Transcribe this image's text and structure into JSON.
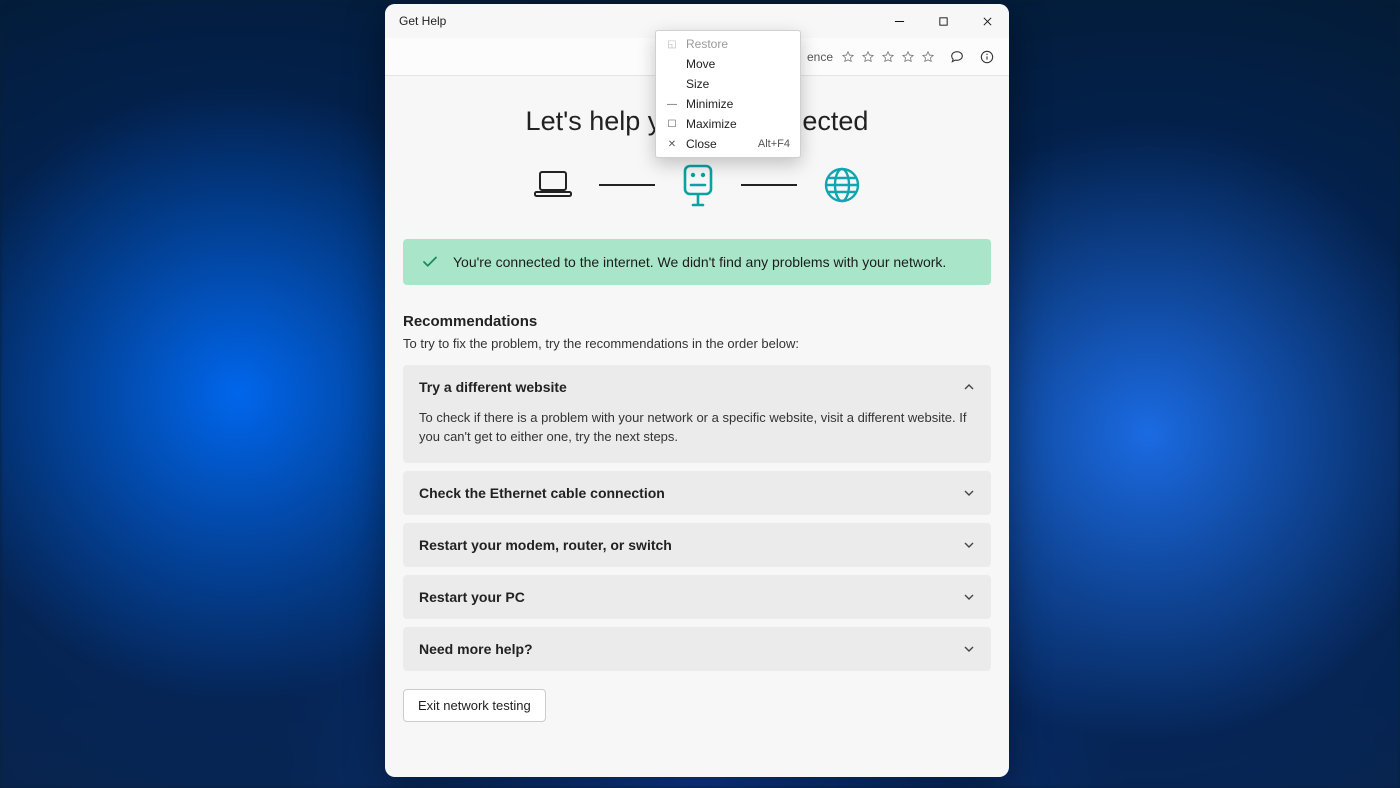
{
  "window": {
    "title": "Get Help"
  },
  "toolbar": {
    "experience_label": "ence"
  },
  "sysmenu": {
    "items": [
      {
        "label": "Restore",
        "key": "restore"
      },
      {
        "label": "Move",
        "key": "move"
      },
      {
        "label": "Size",
        "key": "size"
      },
      {
        "label": "Minimize",
        "key": "minimize"
      },
      {
        "label": "Maximize",
        "key": "maximize"
      },
      {
        "label": "Close",
        "key": "close",
        "accel": "Alt+F4"
      }
    ]
  },
  "main": {
    "headline": "Let's help you get connected",
    "status_text": "You're connected to the internet. We didn't find any problems with your network.",
    "rec_title": "Recommendations",
    "rec_sub": "To try to fix the problem, try the recommendations in the order below:",
    "cards": [
      {
        "title": "Try a different website",
        "body": "To check if there is a problem with your network or a specific website, visit a different website. If you can't get to either one, try the next steps.",
        "expanded": true
      },
      {
        "title": "Check the Ethernet cable connection",
        "expanded": false
      },
      {
        "title": "Restart your modem, router, or switch",
        "expanded": false
      },
      {
        "title": "Restart your PC",
        "expanded": false
      },
      {
        "title": "Need more help?",
        "expanded": false
      }
    ],
    "exit_label": "Exit network testing"
  }
}
